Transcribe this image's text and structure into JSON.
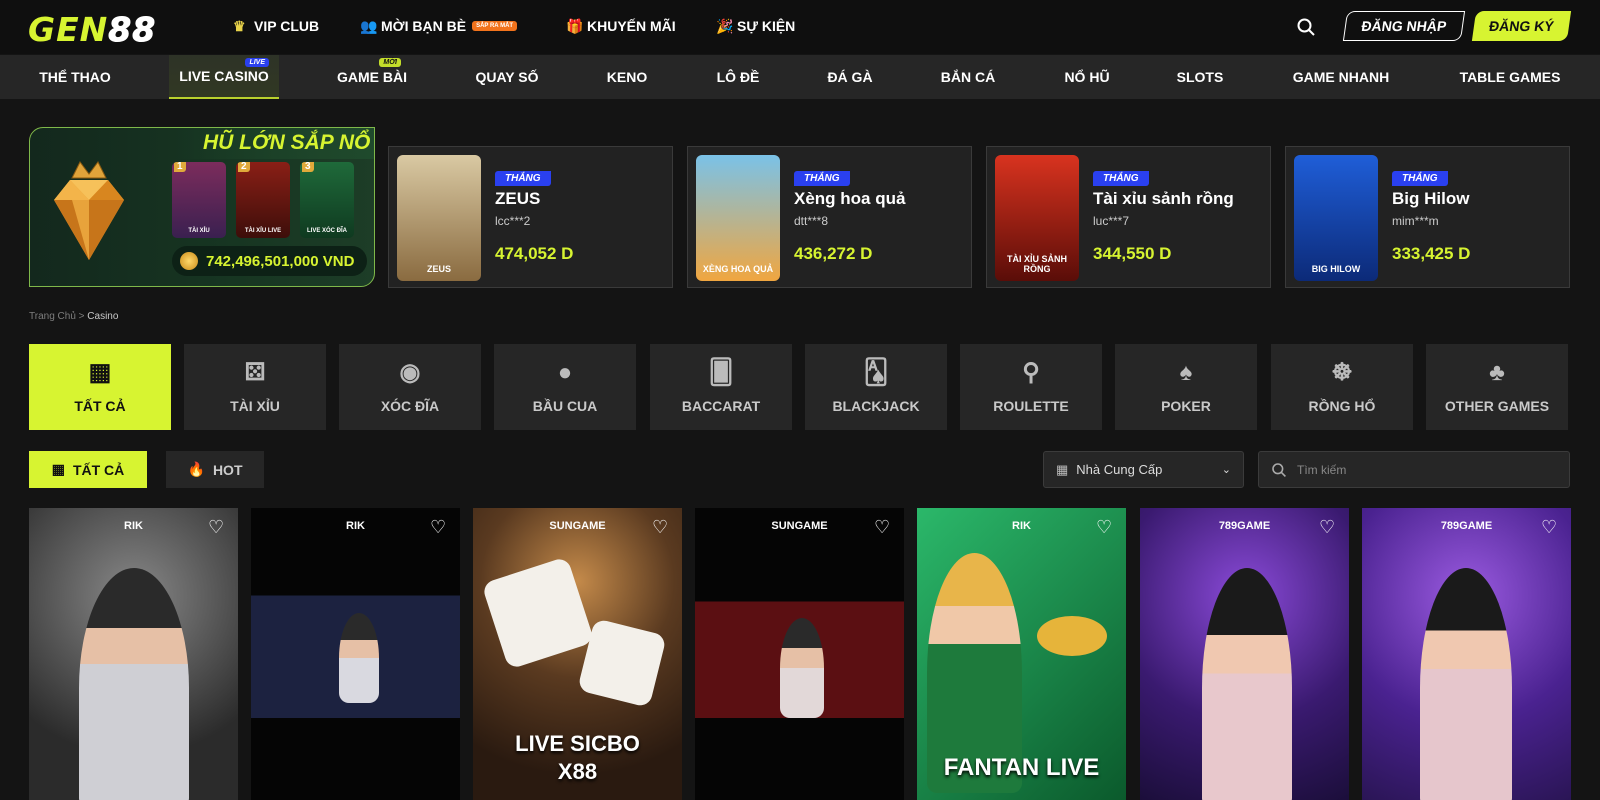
{
  "logo": {
    "part1": "GEN",
    "part2": "88"
  },
  "topnav": [
    {
      "label": "VIP CLUB",
      "icon": "crown-icon"
    },
    {
      "label": "MỜI BẠN BÈ",
      "icon": "users-icon",
      "tag": "SẮP RA MẮT"
    },
    {
      "label": "KHUYẾN MÃI",
      "icon": "gift-icon"
    },
    {
      "label": "SỰ KIỆN",
      "icon": "party-icon"
    }
  ],
  "auth": {
    "login": "ĐĂNG NHẬP",
    "register": "ĐĂNG KÝ"
  },
  "categories": [
    {
      "label": "THỂ THAO"
    },
    {
      "label": "LIVE CASINO",
      "tag": "LIVE",
      "active": true
    },
    {
      "label": "GAME BÀI",
      "tag": "MỚI"
    },
    {
      "label": "QUAY SỐ"
    },
    {
      "label": "KENO"
    },
    {
      "label": "LÔ ĐỀ"
    },
    {
      "label": "ĐÁ GÀ"
    },
    {
      "label": "BẮN CÁ"
    },
    {
      "label": "NỔ HŨ"
    },
    {
      "label": "SLOTS"
    },
    {
      "label": "GAME NHANH"
    },
    {
      "label": "TABLE GAMES"
    }
  ],
  "jackpot": {
    "title": "HŨ LỚN SẮP NỔ",
    "games": [
      {
        "rank": "1",
        "label": "TÀI XỈU"
      },
      {
        "rank": "2",
        "label": "TÀI XỈU LIVE"
      },
      {
        "rank": "3",
        "label": "LIVE XÓC ĐĨA"
      }
    ],
    "amount": "742,496,501,000 VND"
  },
  "winners": [
    {
      "badge": "THẮNG",
      "game": "ZEUS",
      "user": "lcc***2",
      "amount": "474,052 D",
      "thumb_label": "ZEUS",
      "colors": [
        "#d9c9a3",
        "#8a6b40"
      ]
    },
    {
      "badge": "THẮNG",
      "game": "Xèng hoa quả",
      "user": "dtt***8",
      "amount": "436,272 D",
      "thumb_label": "XÈNG HOA QUẢ",
      "colors": [
        "#f0a640",
        "#7ac2e8"
      ]
    },
    {
      "badge": "THẮNG",
      "game": "Tài xỉu sảnh rồng",
      "user": "luc***7",
      "amount": "344,550 D",
      "thumb_label": "TÀI XỈU SẢNH RỒNG",
      "colors": [
        "#d9331f",
        "#5a0d08"
      ]
    },
    {
      "badge": "THẮNG",
      "game": "Big Hilow",
      "user": "mim***m",
      "amount": "333,425 D",
      "thumb_label": "BIG HILOW",
      "colors": [
        "#1f5ed8",
        "#0c2a78"
      ]
    }
  ],
  "breadcrumb": {
    "home": "Trang Chủ",
    "sep": ">",
    "current": "Casino"
  },
  "game_types": [
    {
      "label": "TẤT CẢ",
      "icon": "grid-icon",
      "active": true
    },
    {
      "label": "TÀI XỈU",
      "icon": "dice-icon"
    },
    {
      "label": "XÓC ĐĨA",
      "icon": "disc-icon"
    },
    {
      "label": "BẦU CUA",
      "icon": "gourd-icon"
    },
    {
      "label": "BACCARAT",
      "icon": "cards-icon"
    },
    {
      "label": "BLACKJACK",
      "icon": "blackjack-icon"
    },
    {
      "label": "ROULETTE",
      "icon": "roulette-icon"
    },
    {
      "label": "POKER",
      "icon": "poker-icon"
    },
    {
      "label": "RỒNG HỔ",
      "icon": "tiger-icon"
    },
    {
      "label": "OTHER GAMES",
      "icon": "other-games-icon"
    }
  ],
  "filters": {
    "all": "TẤT CẢ",
    "hot": "HOT"
  },
  "provider_select": {
    "value": "Nhà Cung Cấp"
  },
  "search": {
    "placeholder": "Tìm kiếm"
  },
  "cards": [
    {
      "provider": "RIK",
      "title": "",
      "bg": [
        "#2b2b2b",
        "#8b8b8b"
      ]
    },
    {
      "provider": "RIK",
      "title": "",
      "bg": [
        "#050505",
        "#1c2240"
      ]
    },
    {
      "provider": "SUNGAME",
      "title": "LIVE SICBO X88",
      "bg": [
        "#5a3a20",
        "#2a1a10"
      ]
    },
    {
      "provider": "SUNGAME",
      "title": "",
      "bg": [
        "#050505",
        "#5b0f12"
      ]
    },
    {
      "provider": "RIK",
      "title": "FANTAN LIVE",
      "bg": [
        "#1d9a58",
        "#0b5a2c"
      ]
    },
    {
      "provider": "789GAME",
      "title": "",
      "bg": [
        "#5b2aa8",
        "#1b0e3a"
      ]
    },
    {
      "provider": "789GAME",
      "title": "",
      "bg": [
        "#6b35c0",
        "#2a1555"
      ]
    }
  ],
  "theme": {
    "accent": "#d7f431",
    "badge_blue": "#2a40f0"
  }
}
